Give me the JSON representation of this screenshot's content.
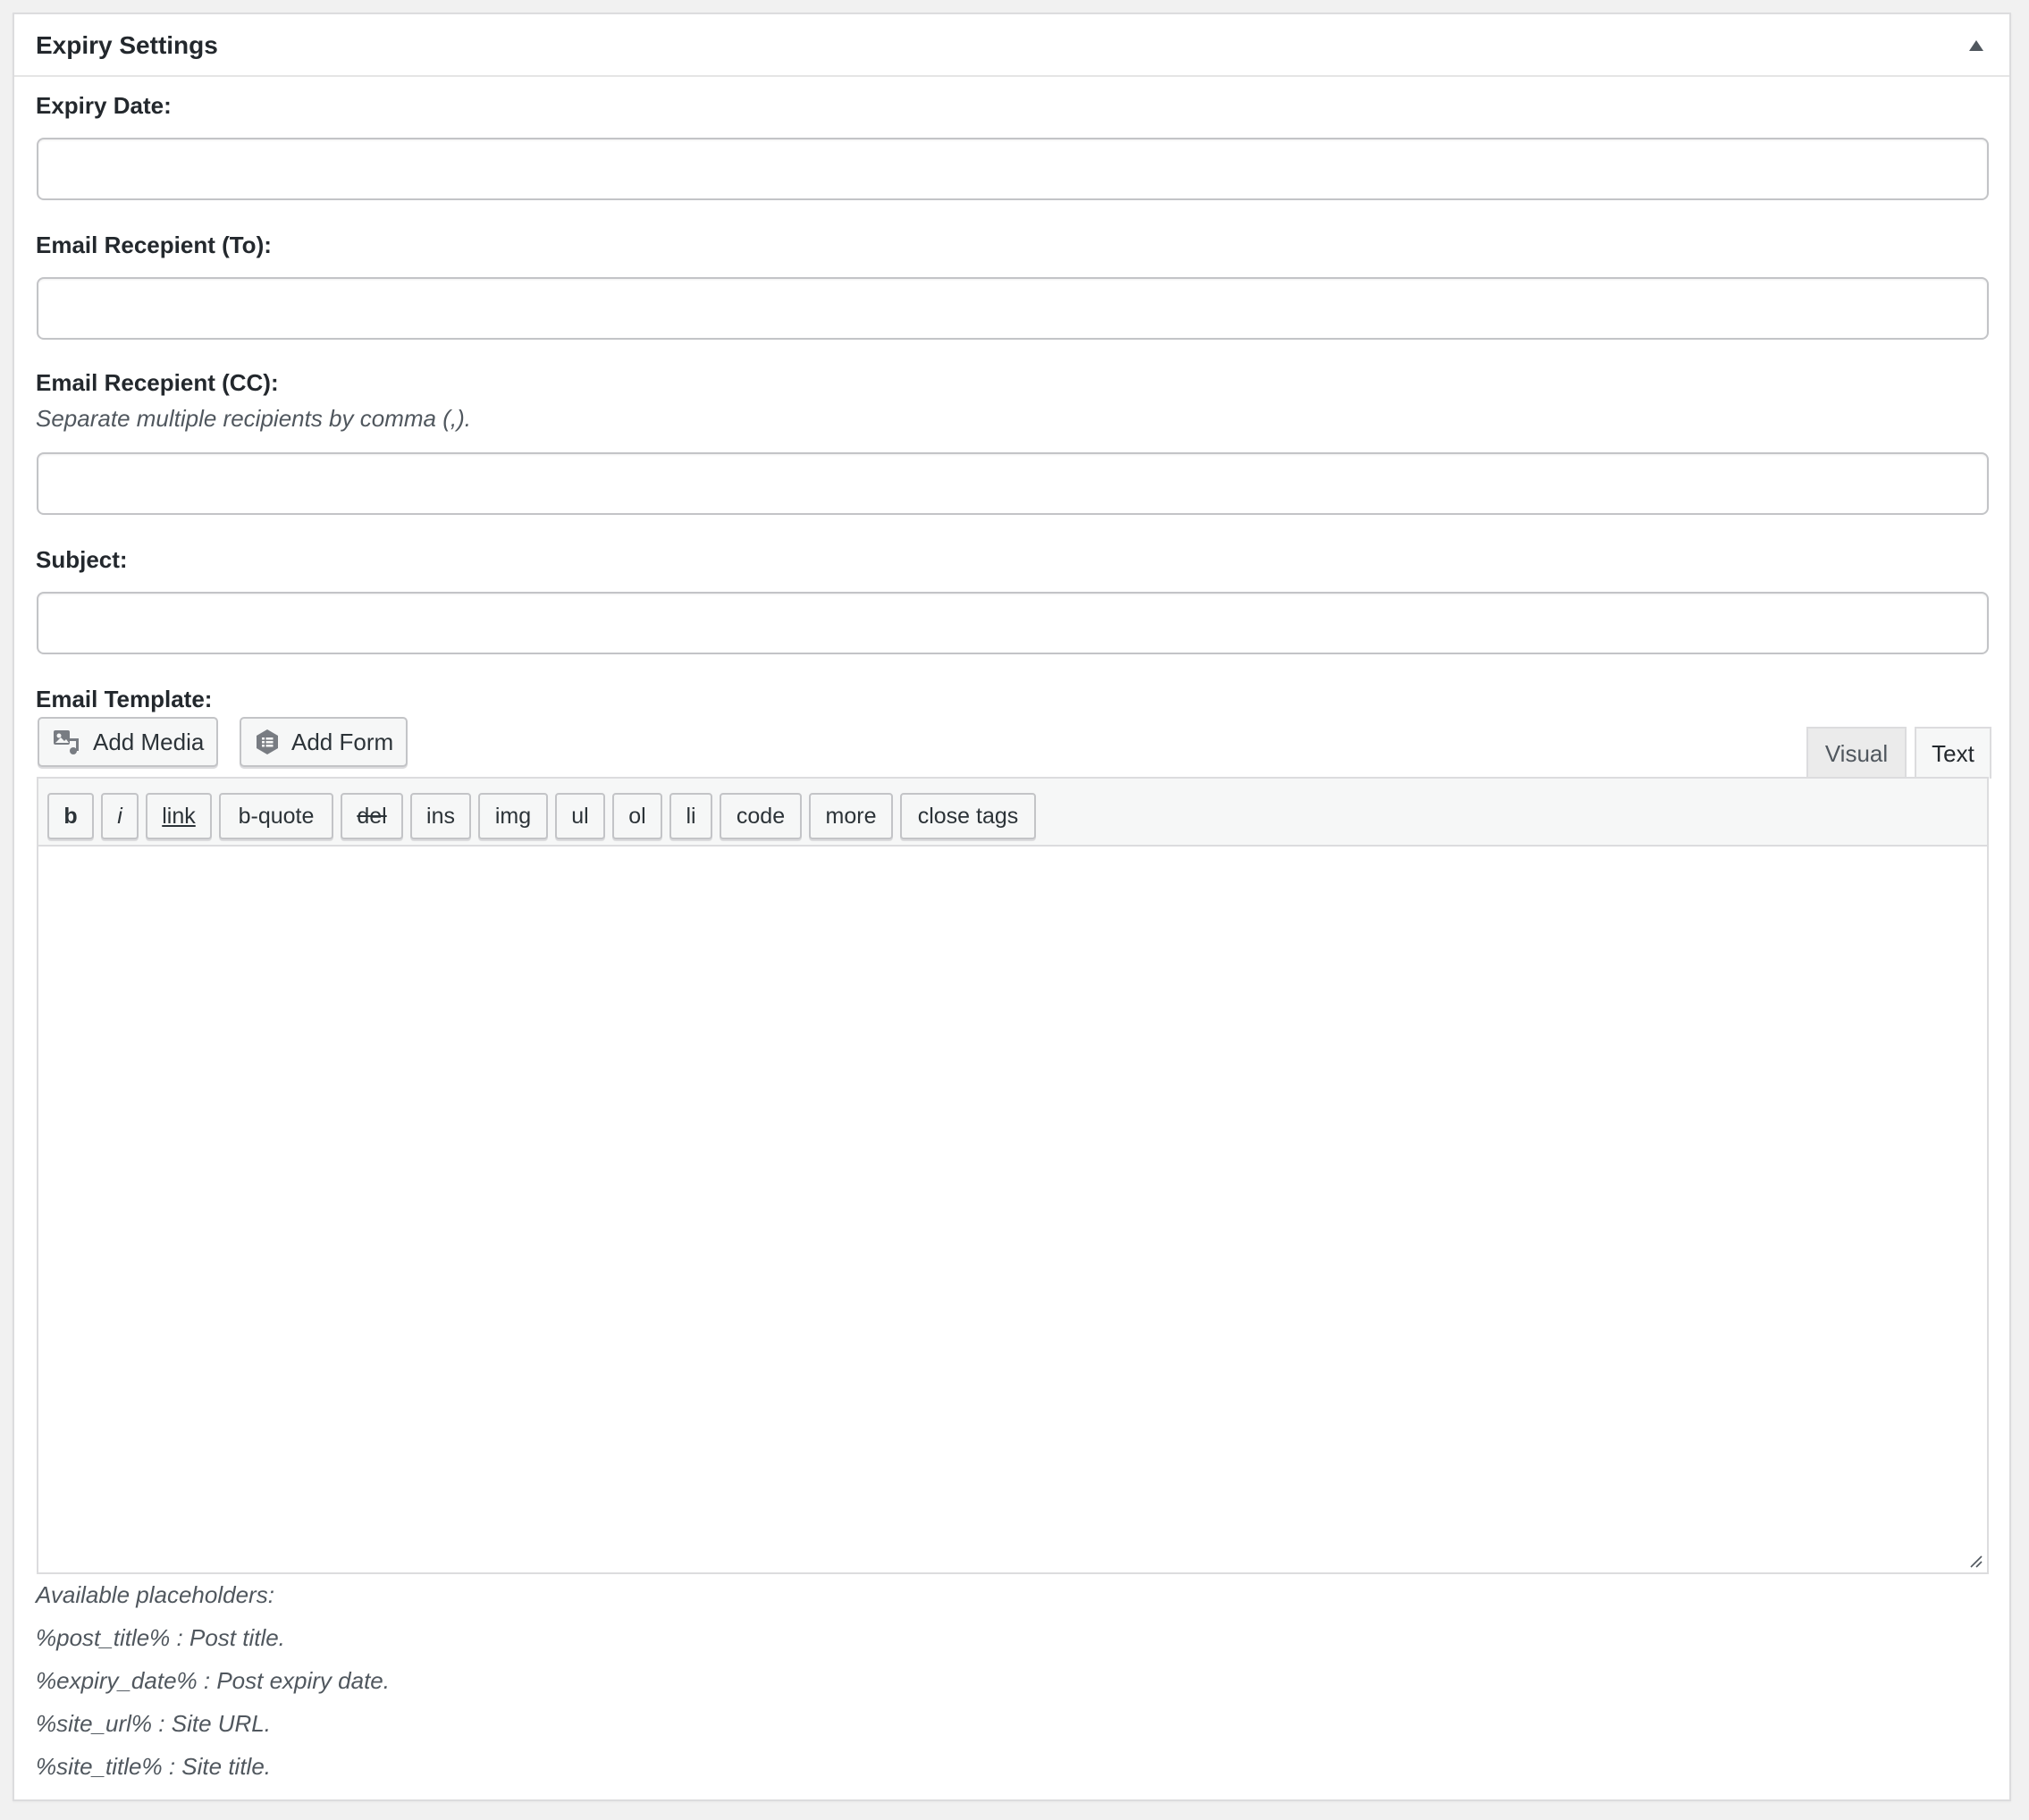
{
  "metabox": {
    "title": "Expiry Settings",
    "toggle_icon": "triangle-up-icon"
  },
  "fields": {
    "expiry_date": {
      "label": "Expiry Date:",
      "value": "",
      "placeholder": ""
    },
    "email_to": {
      "label": "Email Recepient (To):",
      "value": "",
      "placeholder": ""
    },
    "email_cc": {
      "label": "Email Recepient (CC):",
      "description": "Separate multiple recipients by comma (,).",
      "value": "",
      "placeholder": ""
    },
    "subject": {
      "label": "Subject:",
      "value": "",
      "placeholder": ""
    }
  },
  "editor": {
    "label": "Email Template:",
    "add_media_label": "Add Media",
    "add_media_icon": "media-icon",
    "add_form_label": "Add Form",
    "add_form_icon": "form-icon",
    "tabs": {
      "visual": "Visual",
      "text": "Text",
      "active": "Text"
    },
    "quicktags": [
      "b",
      "i",
      "link",
      "b-quote",
      "del",
      "ins",
      "img",
      "ul",
      "ol",
      "li",
      "code",
      "more",
      "close tags"
    ],
    "content": ""
  },
  "placeholders": {
    "heading": "Available placeholders:",
    "items": [
      "%post_title% : Post title.",
      "%expiry_date% : Post expiry date.",
      "%site_url% : Site URL.",
      "%site_title% : Site title."
    ]
  }
}
